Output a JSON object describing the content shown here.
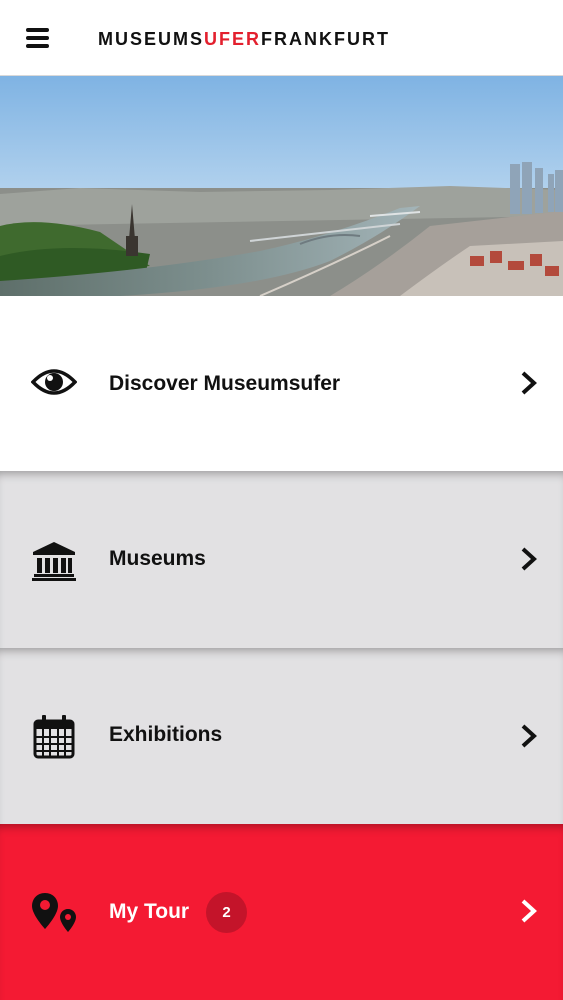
{
  "header": {
    "logo_part1": "MUSEUMS",
    "logo_part2": "UFER",
    "logo_part3": "FRANKFURT"
  },
  "colors": {
    "accent": "#e3202e",
    "tour_background": "#f41a33",
    "row_grey": "#e2e1e3"
  },
  "menu": {
    "discover": {
      "label": "Discover Museumsufer",
      "icon": "eye-icon"
    },
    "museums": {
      "label": "Museums",
      "icon": "museum-building-icon"
    },
    "exhibitions": {
      "label": "Exhibitions",
      "icon": "calendar-icon"
    },
    "tour": {
      "label": "My Tour",
      "icon": "map-pin-icon",
      "count": "2"
    }
  }
}
